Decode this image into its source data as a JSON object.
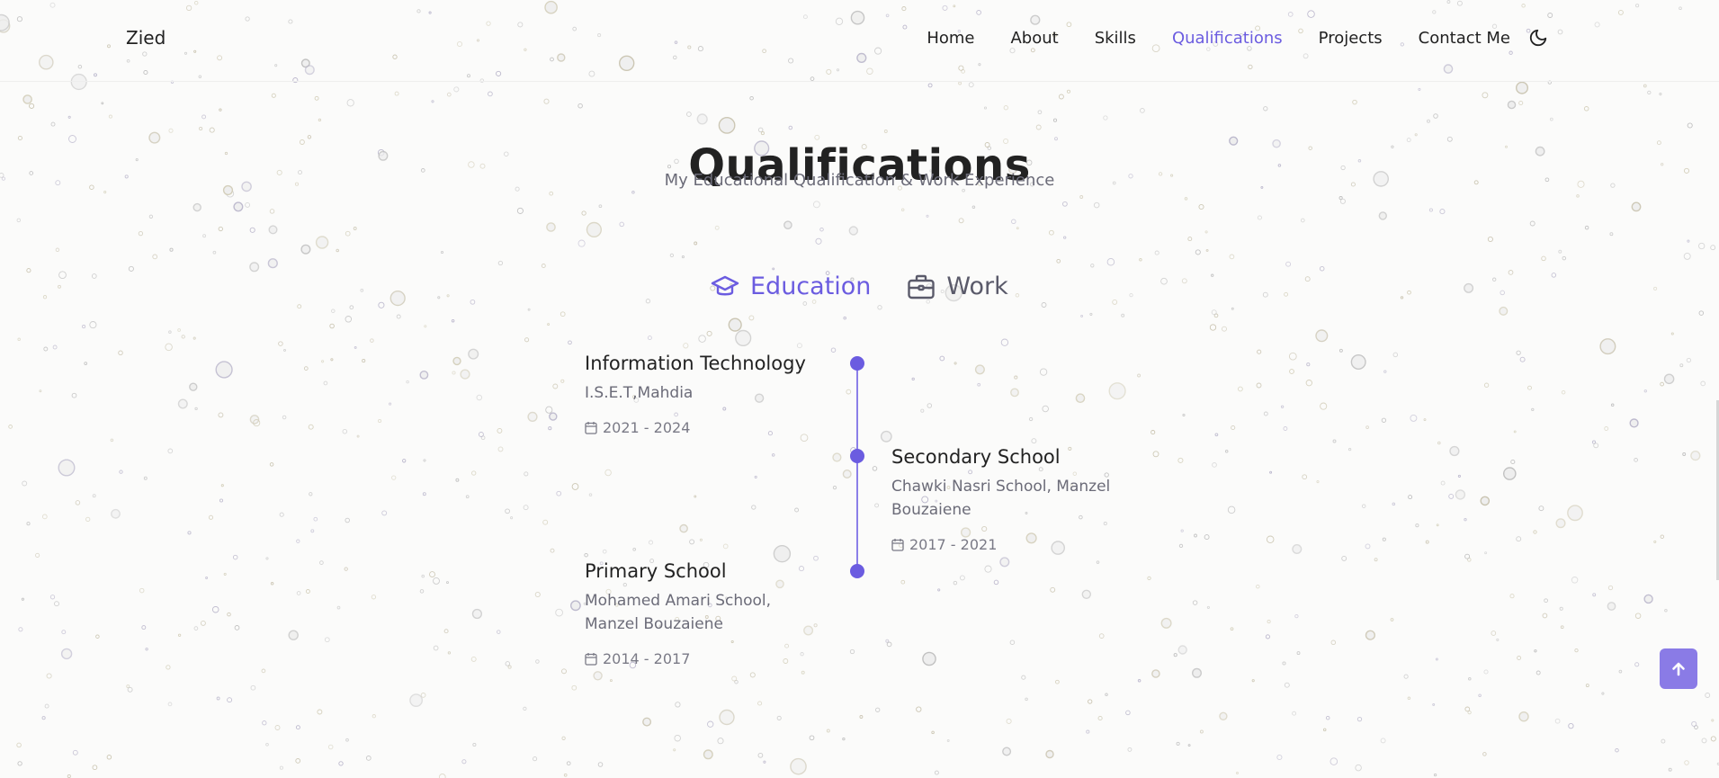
{
  "header": {
    "logo": "Zied",
    "nav": [
      {
        "label": "Home"
      },
      {
        "label": "About"
      },
      {
        "label": "Skills"
      },
      {
        "label": "Qualifications"
      },
      {
        "label": "Projects"
      },
      {
        "label": "Contact Me"
      }
    ],
    "active_index": 3,
    "theme_icon": "moon-icon"
  },
  "section": {
    "title": "Qualifications",
    "subtitle": "My Educational Qualification & Work Experience"
  },
  "tabs": [
    {
      "label": "Education",
      "icon": "graduation-cap-icon",
      "active": true
    },
    {
      "label": "Work",
      "icon": "briefcase-icon",
      "active": false
    }
  ],
  "timeline": [
    {
      "title": "Information Technology",
      "subtitle": "I.S.E.T,Mahdia",
      "date": "2021 - 2024",
      "side": "left"
    },
    {
      "title": "Secondary School",
      "subtitle": "Chawki Nasri School, Manzel Bouzaiene",
      "date": "2017 - 2021",
      "side": "right"
    },
    {
      "title": "Primary School",
      "subtitle": "Mohamed Amari School, Manzel Bouzaiene",
      "date": "2014 - 2017",
      "side": "left"
    }
  ],
  "colors": {
    "accent": "#6b5ce0",
    "scroll_button": "#8a7be6",
    "text": "#222222",
    "muted": "#6b6b78"
  },
  "scroll_top_icon": "arrow-up-icon"
}
